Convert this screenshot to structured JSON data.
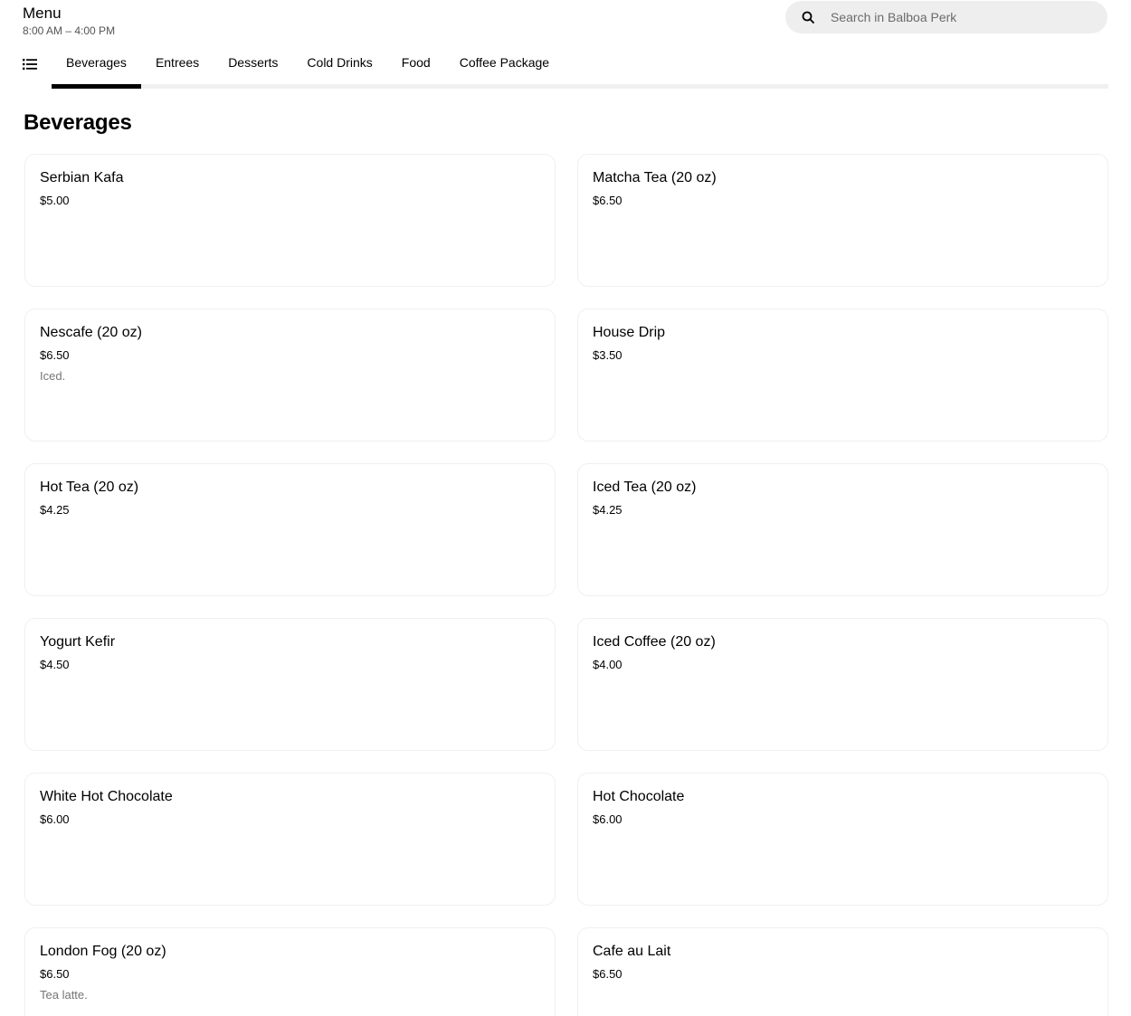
{
  "header": {
    "title": "Menu",
    "hours": "8:00 AM – 4:00 PM"
  },
  "search": {
    "placeholder": "Search in Balboa Perk",
    "value": ""
  },
  "categories": {
    "active_index": 0,
    "tabs": [
      {
        "label": "Beverages"
      },
      {
        "label": "Entrees"
      },
      {
        "label": "Desserts"
      },
      {
        "label": "Cold Drinks"
      },
      {
        "label": "Food"
      },
      {
        "label": "Coffee Package"
      }
    ]
  },
  "section": {
    "title": "Beverages",
    "items": [
      {
        "name": "Serbian Kafa",
        "price": "$5.00",
        "description": ""
      },
      {
        "name": "Matcha Tea (20 oz)",
        "price": "$6.50",
        "description": ""
      },
      {
        "name": "Nescafe (20 oz)",
        "price": "$6.50",
        "description": "Iced."
      },
      {
        "name": "House Drip",
        "price": "$3.50",
        "description": ""
      },
      {
        "name": "Hot Tea (20 oz)",
        "price": "$4.25",
        "description": ""
      },
      {
        "name": "Iced Tea (20 oz)",
        "price": "$4.25",
        "description": ""
      },
      {
        "name": "Yogurt Kefir",
        "price": "$4.50",
        "description": ""
      },
      {
        "name": "Iced Coffee (20 oz)",
        "price": "$4.00",
        "description": ""
      },
      {
        "name": "White Hot Chocolate",
        "price": "$6.00",
        "description": ""
      },
      {
        "name": "Hot Chocolate",
        "price": "$6.00",
        "description": ""
      },
      {
        "name": "London Fog (20 oz)",
        "price": "$6.50",
        "description": "Tea latte."
      },
      {
        "name": "Cafe au Lait",
        "price": "$6.50",
        "description": ""
      }
    ]
  },
  "icons": {
    "search": "search-icon",
    "category_list": "list-icon"
  },
  "colors": {
    "active_tab_underline": "#000000",
    "search_bg": "#eeeeee",
    "card_border": "#f0f0f0",
    "muted_text": "#757575"
  }
}
